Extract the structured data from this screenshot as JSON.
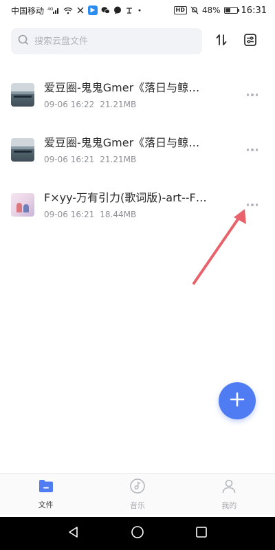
{
  "status_bar": {
    "carrier": "中国移动",
    "signal_label": "4G",
    "battery_percent": "48%",
    "battery_level": 0.48,
    "time": "16:31"
  },
  "search": {
    "placeholder": "搜索云盘文件"
  },
  "toolbar": {
    "sort_icon": "sort-icon",
    "filter_icon": "filter-settings-icon"
  },
  "files": [
    {
      "name": "爱豆圈-鬼鬼Gmer《落日与鲸鱼》",
      "date": "09-06 16:22",
      "size": "21.21MB",
      "thumb": "lake-thumbnail"
    },
    {
      "name": "爱豆圈-鬼鬼Gmer《落日与鲸鱼》",
      "date": "09-06 16:21",
      "size": "21.21MB",
      "thumb": "lake-thumbnail"
    },
    {
      "name": "F×yy-万有引力(歌词版)-art--F×yy",
      "date": "09-06 16:21",
      "size": "18.44MB",
      "thumb": "anime-thumbnail"
    }
  ],
  "fab": {
    "icon": "plus-icon"
  },
  "tabs": [
    {
      "label": "文件",
      "icon": "folder-icon",
      "active": true
    },
    {
      "label": "音乐",
      "icon": "music-disc-icon",
      "active": false
    },
    {
      "label": "我的",
      "icon": "person-icon",
      "active": false
    }
  ],
  "nav": {
    "back": "back-icon",
    "home": "home-icon",
    "recent": "recent-apps-icon"
  },
  "colors": {
    "accent": "#4f7cf2",
    "annotation_arrow": "#e8626b",
    "search_bg": "#f2f3f7",
    "meta_text": "#8d9097"
  }
}
